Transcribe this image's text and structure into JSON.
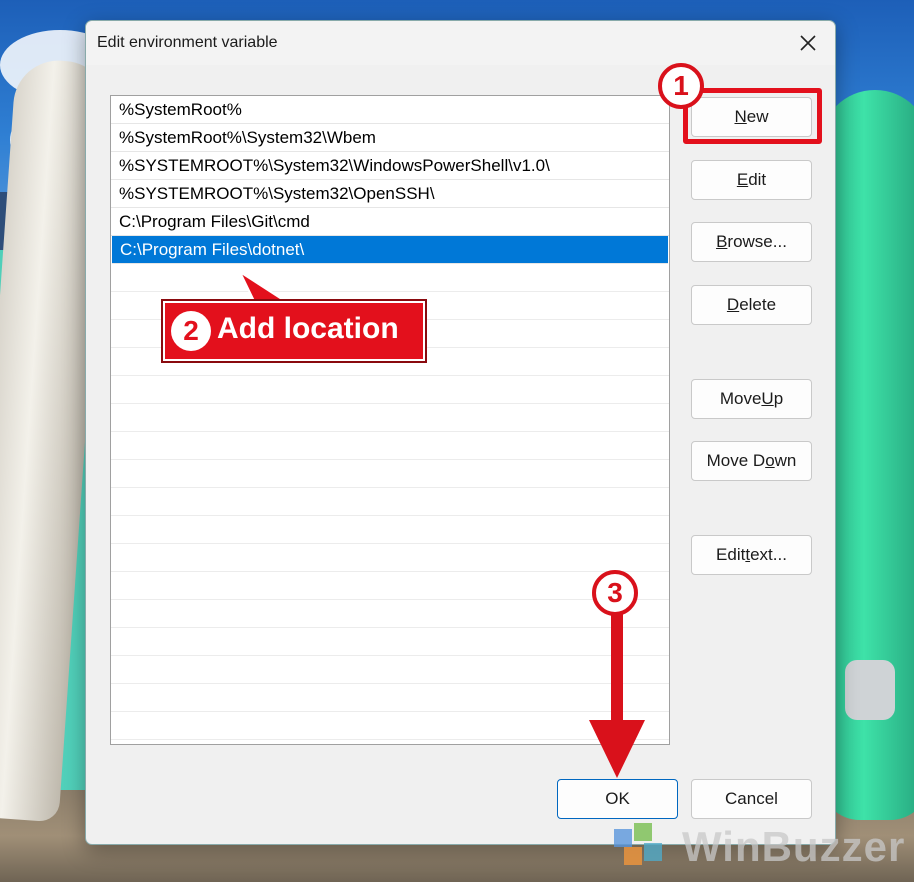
{
  "dialog": {
    "title": "Edit environment variable",
    "close_icon": "close-icon"
  },
  "list": {
    "items": [
      "%SystemRoot%",
      "%SystemRoot%\\System32\\Wbem",
      "%SYSTEMROOT%\\System32\\WindowsPowerShell\\v1.0\\",
      "%SYSTEMROOT%\\System32\\OpenSSH\\",
      "C:\\Program Files\\Git\\cmd",
      "C:\\Program Files\\dotnet\\"
    ],
    "selected_index": 5
  },
  "buttons": {
    "new": {
      "pre": "",
      "u": "N",
      "post": "ew"
    },
    "edit": {
      "pre": "",
      "u": "E",
      "post": "dit"
    },
    "browse": {
      "pre": "",
      "u": "B",
      "post": "rowse..."
    },
    "delete": {
      "pre": "",
      "u": "D",
      "post": "elete"
    },
    "move_up": {
      "pre": "Move ",
      "u": "U",
      "post": "p"
    },
    "move_down": {
      "pre": "Move D",
      "u": "o",
      "post": "wn"
    },
    "edit_text": {
      "pre": "Edit ",
      "u": "t",
      "post": "ext..."
    },
    "ok": "OK",
    "cancel": "Cancel"
  },
  "annotations": {
    "step1": "1",
    "step2": "2",
    "step2_label": "Add location",
    "step3": "3"
  },
  "watermark": "WinBuzzer",
  "colors": {
    "selection": "#0078d7",
    "annotation_red": "#e3101c"
  }
}
